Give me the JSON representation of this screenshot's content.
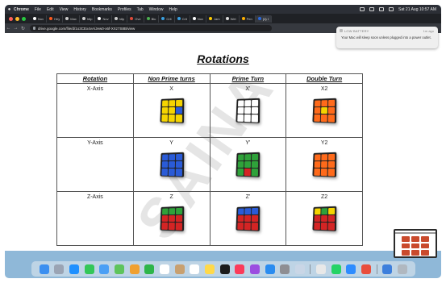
{
  "menubar": {
    "items": [
      "Chrome",
      "File",
      "Edit",
      "View",
      "History",
      "Bookmarks",
      "Profiles",
      "Tab",
      "Window",
      "Help"
    ],
    "datetime": "Sat 21 Aug 10:57 AM"
  },
  "tabs": [
    {
      "label": "Nov",
      "color": "#ffffff"
    },
    {
      "label": "Hey",
      "color": "#ff5a1f"
    },
    {
      "label": "Max",
      "color": "#cccccc"
    },
    {
      "label": "http",
      "color": "#cccccc"
    },
    {
      "label": "Nov",
      "color": "#ffffff"
    },
    {
      "label": "http",
      "color": "#cccccc"
    },
    {
      "label": "Ove",
      "color": "#e04a3a"
    },
    {
      "label": "Blu",
      "color": "#4caf50"
    },
    {
      "label": "Crit",
      "color": "#3aa0e0"
    },
    {
      "label": "Crit",
      "color": "#3aa0e0"
    },
    {
      "label": "Nov",
      "color": "#ffffff"
    },
    {
      "label": "Jam",
      "color": "#ffcc00"
    },
    {
      "label": "Wet",
      "color": "#dddddd"
    },
    {
      "label": "Pen",
      "color": "#ffb000"
    },
    {
      "label": "(1) I",
      "color": "#2a6ae0"
    }
  ],
  "address": {
    "url": "drive.google.com/file/d/1o3CEx4vA/Jew0-x6f-XXz7S8B/view"
  },
  "notification": {
    "title": "LOW BATTERY",
    "time": "1m ago",
    "body": "Your Mac will sleep soon unless plugged into a power outlet."
  },
  "document": {
    "title": "Rotations",
    "watermark": "SAINA",
    "headers": [
      "Rotation",
      "Non Prime turns",
      "Prime Turn",
      "Double Turn"
    ],
    "rows": [
      {
        "axis": "X-Axis",
        "moves": [
          "X",
          "X'",
          "X2"
        ]
      },
      {
        "axis": "Y-Axis",
        "moves": [
          "Y",
          "Y'",
          "Y2"
        ]
      },
      {
        "axis": "Z-Axis",
        "moves": [
          "Z",
          "Z'",
          "Z2"
        ]
      }
    ],
    "cubes": [
      [
        "#f5d400",
        "#f5d400",
        "#f5d400",
        "#f5d400",
        "#f5d400",
        "#2a5bd7",
        "#f5d400",
        "#f5d400",
        "#f5d400"
      ],
      [
        "#ffffff",
        "#ffffff",
        "#ffffff",
        "#ffffff",
        "#ffffff",
        "#ffffff",
        "#ffffff",
        "#ffffff",
        "#ffffff"
      ],
      [
        "#ff6a1a",
        "#ff6a1a",
        "#ff6a1a",
        "#ff6a1a",
        "#f5d400",
        "#ff6a1a",
        "#ff6a1a",
        "#ff6a1a",
        "#ff6a1a"
      ],
      [
        "#2a5bd7",
        "#2a5bd7",
        "#2a5bd7",
        "#2a5bd7",
        "#2a5bd7",
        "#2a5bd7",
        "#2a5bd7",
        "#2a5bd7",
        "#2a5bd7"
      ],
      [
        "#2fa23a",
        "#2fa23a",
        "#2fa23a",
        "#2fa23a",
        "#2fa23a",
        "#2fa23a",
        "#2fa23a",
        "#d42424",
        "#2fa23a"
      ],
      [
        "#ff6a1a",
        "#ff6a1a",
        "#ff6a1a",
        "#ff6a1a",
        "#ff6a1a",
        "#ff6a1a",
        "#ff6a1a",
        "#ff6a1a",
        "#ff6a1a"
      ],
      [
        "#2fa23a",
        "#2fa23a",
        "#2fa23a",
        "#d42424",
        "#d42424",
        "#d42424",
        "#d42424",
        "#d42424",
        "#d42424"
      ],
      [
        "#2a5bd7",
        "#2a5bd7",
        "#2a5bd7",
        "#d42424",
        "#d42424",
        "#d42424",
        "#d42424",
        "#d42424",
        "#d42424"
      ],
      [
        "#f5d400",
        "#2fa23a",
        "#f5d400",
        "#d42424",
        "#d42424",
        "#d42424",
        "#d42424",
        "#d42424",
        "#d42424"
      ]
    ]
  },
  "dock": {
    "icons": [
      "finder-icon",
      "launchpad-icon",
      "safari-icon",
      "messages-icon",
      "mail-icon",
      "maps-icon",
      "photos-icon",
      "facetime-icon",
      "calendar-icon",
      "contacts-icon",
      "reminders-icon",
      "notes-icon",
      "tv-icon",
      "music-icon",
      "podcasts-icon",
      "appstore-icon",
      "settings-icon",
      "preview-icon",
      "chrome-icon",
      "whatsapp-icon",
      "zoom-icon",
      "app-icon",
      "app-icon-2",
      "trash-icon"
    ],
    "colors": [
      "#3b8ff0",
      "#9aa4b4",
      "#1e90ff",
      "#33c759",
      "#4a9ff5",
      "#5ec45c",
      "#f0a030",
      "#2db54a",
      "#ffffff",
      "#c8a070",
      "#ffffff",
      "#ffd94a",
      "#1c1c1c",
      "#fb3b5a",
      "#9b4de0",
      "#2a8cf0",
      "#8e8e93",
      "#c9d6e6",
      "#e8e8e8",
      "#25d366",
      "#2d8cff",
      "#e94e3d",
      "#3d7fdc",
      "#b0b8c0"
    ]
  }
}
